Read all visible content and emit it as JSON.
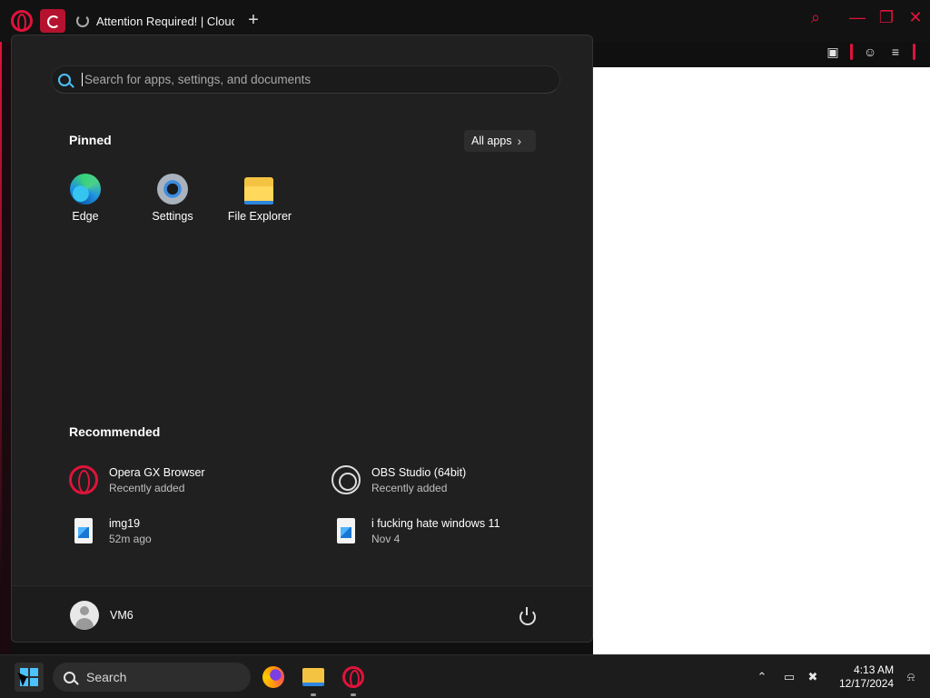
{
  "browser": {
    "tab_title": "Attention Required! | Cloudflare",
    "new_tab_icon": "plus-icon",
    "toolbar_icons": [
      "camera-icon",
      "account-icon",
      "easy-setup-icon"
    ],
    "accent_color": "#e0133b"
  },
  "start_menu": {
    "search_placeholder": "Search for apps, settings, and documents",
    "pinned_title": "Pinned",
    "all_apps_label": "All apps",
    "pinned_apps": [
      {
        "label": "Edge",
        "icon": "edge-icon"
      },
      {
        "label": "Settings",
        "icon": "settings-icon"
      },
      {
        "label": "File Explorer",
        "icon": "file-explorer-icon"
      }
    ],
    "recommended_title": "Recommended",
    "recommended": [
      {
        "name": "Opera GX Browser",
        "sub": "Recently added",
        "icon": "opera-gx-icon"
      },
      {
        "name": "OBS Studio (64bit)",
        "sub": "Recently added",
        "icon": "obs-icon"
      },
      {
        "name": "img19",
        "sub": "52m ago",
        "icon": "image-file-icon"
      },
      {
        "name": "i fucking hate windows 11",
        "sub": "Nov 4",
        "icon": "image-file-icon"
      }
    ],
    "user_name": "VM6"
  },
  "taskbar": {
    "search_label": "Search",
    "pinned_apps": [
      "firefox-icon",
      "file-explorer-icon",
      "opera-gx-icon"
    ],
    "time": "4:13 AM",
    "date": "12/17/2024"
  }
}
